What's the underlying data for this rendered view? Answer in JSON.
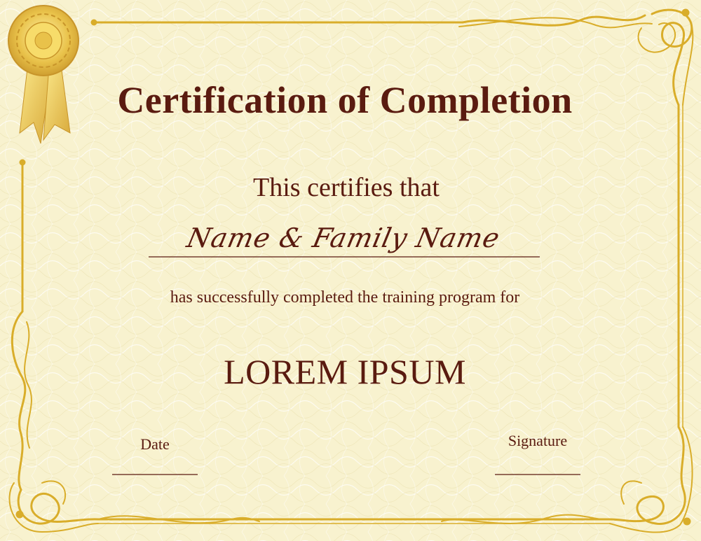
{
  "certificate": {
    "title": "Certification of Completion",
    "subtitle": "This certifies that",
    "recipient_name": "Name & Family Name",
    "body_text": "has successfully completed the training program for",
    "program_name": "LOREM IPSUM",
    "date_label": "Date",
    "signature_label": "Signature"
  },
  "colors": {
    "background": "#f8f2cf",
    "text": "#5a1b10",
    "gold": "#d9ad2a",
    "gold_light": "#f2d66a"
  },
  "icons": {
    "seal": "award-ribbon-icon"
  }
}
